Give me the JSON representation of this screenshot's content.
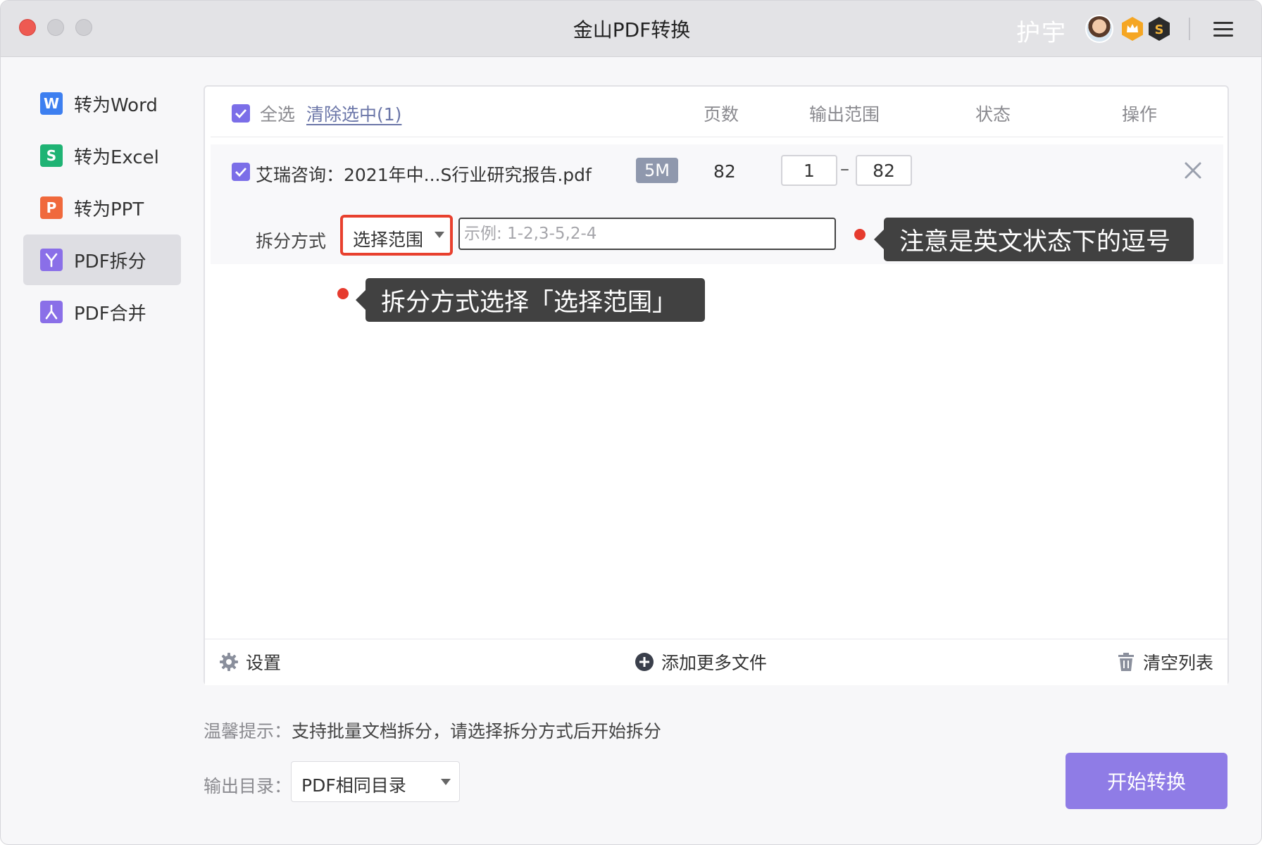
{
  "window": {
    "title": "金山PDF转换",
    "user_name": "护宇"
  },
  "sidebar": {
    "items": [
      {
        "label": "转为Word",
        "icon_letter": "W",
        "color": "#3d7ff0"
      },
      {
        "label": "转为Excel",
        "icon_letter": "S",
        "color": "#1fb374"
      },
      {
        "label": "转为PPT",
        "icon_letter": "P",
        "color": "#f0693c"
      },
      {
        "label": "PDF拆分",
        "icon_letter": "",
        "color": "#8a6fe8",
        "active": true
      },
      {
        "label": "PDF合并",
        "icon_letter": "",
        "color": "#8a6fe8"
      }
    ]
  },
  "table": {
    "select_all": "全选",
    "clear_selection": "清除选中(1)",
    "columns": {
      "pages": "页数",
      "output_range": "输出范围",
      "status": "状态",
      "action": "操作"
    },
    "rows": [
      {
        "filename": "艾瑞咨询：2021年中...S行业研究报告.pdf",
        "size": "5M",
        "pages": "82",
        "range_from": "1",
        "range_to": "82",
        "range_sep": "–",
        "split_label": "拆分方式",
        "split_value": "选择范围",
        "range_placeholder": "示例: 1-2,3-5,2-4"
      }
    ]
  },
  "tooltips": {
    "comma_note": "注意是英文状态下的逗号",
    "split_note": "拆分方式选择「选择范围」"
  },
  "footer": {
    "settings": "设置",
    "add_files": "添加更多文件",
    "clear_list": "清空列表"
  },
  "hint": {
    "label": "温馨提示：",
    "text": "支持批量文档拆分，请选择拆分方式后开始拆分"
  },
  "output": {
    "label": "输出目录：",
    "value": "PDF相同目录"
  },
  "start_button": "开始转换",
  "colors": {
    "accent": "#8f7ce6",
    "checkbox": "#7b6ee8",
    "highlight_red": "#e8402e"
  }
}
